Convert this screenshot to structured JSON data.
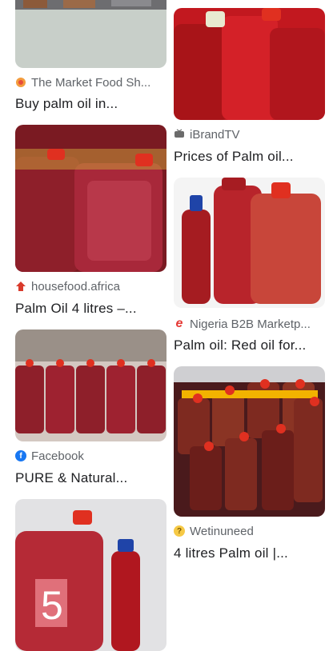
{
  "results": [
    {
      "source": "The Market Food Sh...",
      "title": "Buy palm oil in...",
      "favicon": "market-food-icon"
    },
    {
      "source": "iBrandTV",
      "title": "Prices of Palm oil...",
      "favicon": "ibrandtv-icon"
    },
    {
      "source": "housefood.africa",
      "title": "Palm Oil 4 litres –...",
      "favicon": "housefood-icon"
    },
    {
      "source": "Nigeria B2B Marketp...",
      "title": "Palm oil: Red oil for...",
      "favicon": "edge-e-icon"
    },
    {
      "source": "Facebook",
      "title": "PURE & Natural...",
      "favicon": "facebook-icon"
    },
    {
      "source": "Wetinuneed",
      "title": "4 litres Palm oil |...",
      "favicon": "wetinuneed-icon"
    }
  ],
  "close_label": "×",
  "colors": {
    "oil_red": "#8b1c1c",
    "cap_red": "#e03020",
    "cap_yellow": "#f2b300",
    "text": "#202124",
    "muted": "#5f6368"
  }
}
